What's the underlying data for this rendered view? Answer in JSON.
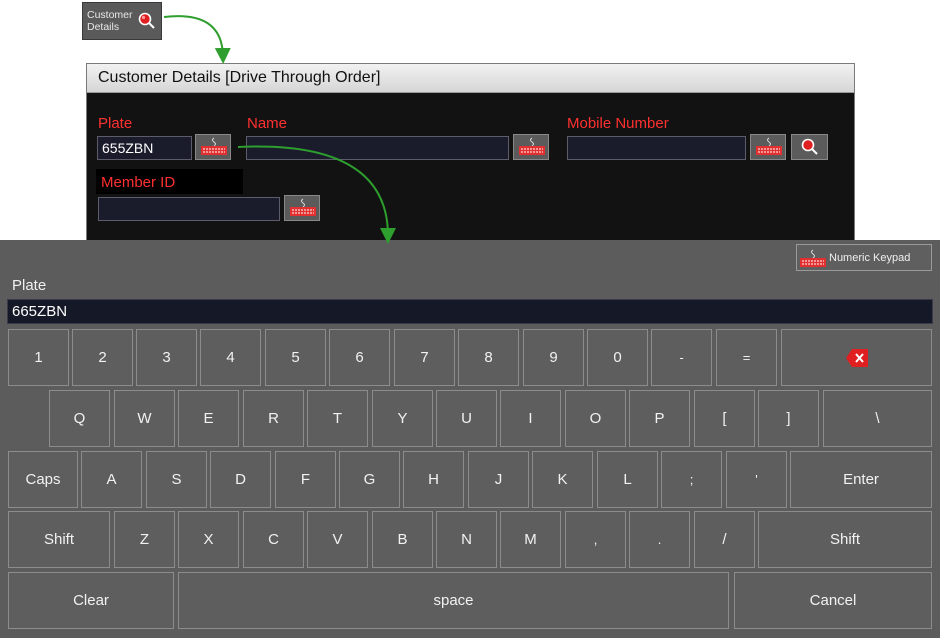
{
  "launcher": {
    "label_line1": "Customer",
    "label_line2": "Details"
  },
  "window": {
    "title": "Customer Details  [Drive Through Order]",
    "fields": {
      "plate": {
        "label": "Plate",
        "value": "655ZBN"
      },
      "name": {
        "label": "Name",
        "value": ""
      },
      "mobile": {
        "label": "Mobile Number",
        "value": ""
      },
      "member": {
        "label": "Member ID",
        "value": ""
      }
    }
  },
  "keyboard": {
    "numeric_label": "Numeric Keypad",
    "field_label": "Plate",
    "field_value": "665ZBN",
    "rows": [
      [
        "1",
        "2",
        "3",
        "4",
        "5",
        "6",
        "7",
        "8",
        "9",
        "0",
        "-",
        "="
      ],
      [
        "Q",
        "W",
        "E",
        "R",
        "T",
        "Y",
        "U",
        "I",
        "O",
        "P",
        "[",
        "]",
        "\\"
      ],
      [
        "Caps",
        "A",
        "S",
        "D",
        "F",
        "G",
        "H",
        "J",
        "K",
        "L",
        ";",
        "'",
        "Enter"
      ],
      [
        "Shift",
        "Z",
        "X",
        "C",
        "V",
        "B",
        "N",
        "M",
        ",",
        ".",
        "/",
        "Shift"
      ],
      [
        "Clear",
        "space",
        "Cancel"
      ]
    ]
  },
  "colors": {
    "label_red": "#ff3030",
    "arrow_green": "#2e9e2e",
    "panel_gray": "#5c5c5c"
  }
}
